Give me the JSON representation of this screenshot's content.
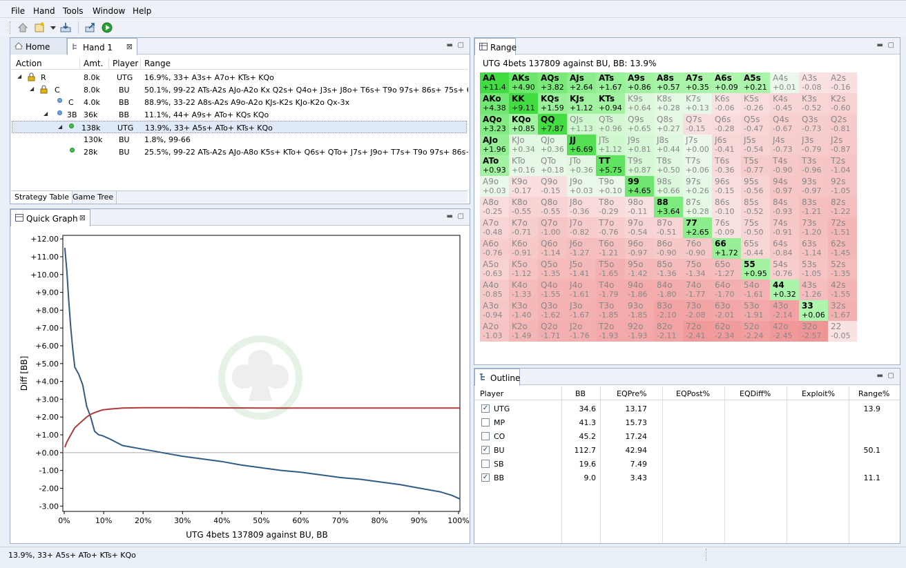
{
  "menu": [
    "File",
    "Hand",
    "Tools",
    "Window",
    "Help"
  ],
  "hand_panel": {
    "tabs": [
      "Home",
      "Hand 1"
    ],
    "headers": [
      "Action",
      "Amt.",
      "Player",
      "Range"
    ],
    "rows": [
      {
        "action": "R",
        "amt": "8.0k",
        "player": "UTG",
        "range": "16.9%, 33+ A3s+ A7o+ KTs+ KQo"
      },
      {
        "action": "C",
        "amt": "8.0k",
        "player": "BU",
        "range": "50.1%, 99-22 ATs-A2s AJo-A2o Kx Q2s+ Q4o+ J3s+ J8o+ T6s+ T9o 97s+ 86s+ 75s+ 64s+ 53"
      },
      {
        "action": "C",
        "amt": "4.0k",
        "player": "BB",
        "range": "88.9%, 33-22 A8s-A2s A9o-A2o KJs-K2s KJo-K2o Qx-3x"
      },
      {
        "action": "3B",
        "amt": "36k",
        "player": "BB",
        "range": "11.1%, 44+ A9s+ ATo+ KQs KQo"
      },
      {
        "action": "",
        "amt": "138k",
        "player": "UTG",
        "range": "13.9%, 33+ A5s+ ATo+ KTs+ KQo"
      },
      {
        "action": "",
        "amt": "130k",
        "player": "BU",
        "range": "1.8%, 99-66"
      },
      {
        "action": "",
        "amt": "28k",
        "player": "BU",
        "range": "25.5%, 99-22 ATs-A2s AJo-A8o K5s+ KTo+ Q6s+ QTo+ J7s+ J9o+ T7s+ T9o 97s+ 86s+ 75s."
      }
    ],
    "bottom_tabs": [
      "Strategy Table",
      "Game Tree"
    ]
  },
  "graph_panel": {
    "tab": "Quick Graph",
    "y_label": "Diff [BB]",
    "x_label": "UTG 4bets 137809 against BU, BB",
    "y_ticks": [
      "+12.00",
      "+11.00",
      "+10.00",
      "+9.00",
      "+8.00",
      "+7.00",
      "+6.00",
      "+5.00",
      "+4.00",
      "+3.00",
      "+2.00",
      "+1.00",
      "+0.00",
      "-1.00",
      "-2.00",
      "-3.00"
    ],
    "x_ticks": [
      "0%",
      "10%",
      "20%",
      "30%",
      "40%",
      "50%",
      "60%",
      "70%",
      "80%",
      "90%",
      "100%"
    ]
  },
  "chart_data": {
    "type": "line",
    "ylim": [
      -3.3,
      12.2
    ],
    "xlim": [
      0,
      100
    ],
    "series": [
      {
        "color": "#2f5b86",
        "x": [
          0.5,
          1,
          1.5,
          2,
          2.5,
          3,
          4,
          5,
          6,
          7,
          8,
          9,
          10,
          12,
          15,
          20,
          25,
          30,
          35,
          40,
          45,
          50,
          55,
          60,
          65,
          70,
          75,
          80,
          85,
          90,
          95,
          98,
          100
        ],
        "y": [
          11.5,
          10.2,
          8.5,
          7,
          5.8,
          4.8,
          4.4,
          3.8,
          2.6,
          2,
          1.2,
          1,
          0.95,
          0.75,
          0.4,
          0.2,
          0,
          -0.2,
          -0.35,
          -0.5,
          -0.7,
          -0.85,
          -1.0,
          -1.1,
          -1.25,
          -1.4,
          -1.5,
          -1.65,
          -1.8,
          -2.0,
          -2.2,
          -2.4,
          -2.6
        ]
      },
      {
        "color": "#b03a3a",
        "x": [
          0.5,
          1,
          2,
          3,
          4,
          5,
          6,
          7,
          8,
          10,
          12,
          15,
          20,
          30,
          50,
          70,
          90,
          100
        ],
        "y": [
          0.3,
          0.6,
          1.0,
          1.4,
          1.6,
          1.8,
          2.0,
          2.15,
          2.25,
          2.4,
          2.45,
          2.5,
          2.52,
          2.52,
          2.5,
          2.5,
          2.5,
          2.5
        ]
      }
    ]
  },
  "range_panel": {
    "tab": "Range",
    "title": "UTG 4bets 137809 against BU, BB: 13.9%",
    "grid": [
      [
        [
          "AA",
          "+11.4"
        ],
        [
          "AKs",
          "+4.90"
        ],
        [
          "AQs",
          "+3.82"
        ],
        [
          "AJs",
          "+2.64"
        ],
        [
          "ATs",
          "+1.67"
        ],
        [
          "A9s",
          "+0.86"
        ],
        [
          "A8s",
          "+0.57"
        ],
        [
          "A7s",
          "+0.35"
        ],
        [
          "A6s",
          "+0.09"
        ],
        [
          "A5s",
          "+0.21"
        ],
        [
          "A4s",
          "+0.01"
        ],
        [
          "A3s",
          "-0.08"
        ],
        [
          "A2s",
          "-0.16"
        ]
      ],
      [
        [
          "AKo",
          "+4.38"
        ],
        [
          "KK",
          "+9.11"
        ],
        [
          "KQs",
          "+1.59"
        ],
        [
          "KJs",
          "+1.12"
        ],
        [
          "KTs",
          "+0.94"
        ],
        [
          "K9s",
          "+0.64"
        ],
        [
          "K8s",
          "+0.28"
        ],
        [
          "K7s",
          "+0.13"
        ],
        [
          "K6s",
          "-0.06"
        ],
        [
          "K5s",
          "-0.26"
        ],
        [
          "K4s",
          "-0.45"
        ],
        [
          "K3s",
          "-0.52"
        ],
        [
          "K2s",
          "-0.60"
        ]
      ],
      [
        [
          "AQo",
          "+3.23"
        ],
        [
          "KQo",
          "+0.85"
        ],
        [
          "QQ",
          "+7.87"
        ],
        [
          "QJs",
          "+1.13"
        ],
        [
          "QTs",
          "+0.96"
        ],
        [
          "Q9s",
          "+0.65"
        ],
        [
          "Q8s",
          "+0.27"
        ],
        [
          "Q7s",
          "-0.15"
        ],
        [
          "Q6s",
          "-0.28"
        ],
        [
          "Q5s",
          "-0.47"
        ],
        [
          "Q4s",
          "-0.67"
        ],
        [
          "Q3s",
          "-0.73"
        ],
        [
          "Q2s",
          "-0.81"
        ]
      ],
      [
        [
          "AJo",
          "+1.96"
        ],
        [
          "KJo",
          "+0.34"
        ],
        [
          "QJo",
          "+0.36"
        ],
        [
          "JJ",
          "+6.69"
        ],
        [
          "JTs",
          "+1.12"
        ],
        [
          "J9s",
          "+0.81"
        ],
        [
          "J8s",
          "+0.44"
        ],
        [
          "J7s",
          "+0.00"
        ],
        [
          "J6s",
          "-0.41"
        ],
        [
          "J5s",
          "-0.54"
        ],
        [
          "J4s",
          "-0.73"
        ],
        [
          "J3s",
          "-0.79"
        ],
        [
          "J2s",
          "-0.87"
        ]
      ],
      [
        [
          "ATo",
          "+0.93"
        ],
        [
          "KTo",
          "+0.16"
        ],
        [
          "QTo",
          "+0.18"
        ],
        [
          "JTo",
          "+0.36"
        ],
        [
          "TT",
          "+5.75"
        ],
        [
          "T9s",
          "+0.87"
        ],
        [
          "T8s",
          "+0.50"
        ],
        [
          "T7s",
          "+0.06"
        ],
        [
          "T6s",
          "-0.36"
        ],
        [
          "T5s",
          "-0.77"
        ],
        [
          "T4s",
          "-0.90"
        ],
        [
          "T3s",
          "-0.96"
        ],
        [
          "T2s",
          "-1.04"
        ]
      ],
      [
        [
          "A9o",
          "+0.03"
        ],
        [
          "K9o",
          "-0.17"
        ],
        [
          "Q9o",
          "-0.15"
        ],
        [
          "J9o",
          "+0.03"
        ],
        [
          "T9o",
          "+0.10"
        ],
        [
          "99",
          "+4.65"
        ],
        [
          "98s",
          "+0.66"
        ],
        [
          "97s",
          "+0.26"
        ],
        [
          "96s",
          "-0.15"
        ],
        [
          "95s",
          "-0.56"
        ],
        [
          "94s",
          "-0.97"
        ],
        [
          "93s",
          "-0.97"
        ],
        [
          "92s",
          "-1.05"
        ]
      ],
      [
        [
          "A8o",
          "-0.25"
        ],
        [
          "K8o",
          "-0.55"
        ],
        [
          "Q8o",
          "-0.55"
        ],
        [
          "J8o",
          "-0.36"
        ],
        [
          "T8o",
          "-0.29"
        ],
        [
          "98o",
          "-0.11"
        ],
        [
          "88",
          "+3.64"
        ],
        [
          "87s",
          "+0.28"
        ],
        [
          "86s",
          "-0.10"
        ],
        [
          "85s",
          "-0.52"
        ],
        [
          "84s",
          "-0.93"
        ],
        [
          "83s",
          "-1.21"
        ],
        [
          "82s",
          "-1.22"
        ]
      ],
      [
        [
          "A7o",
          "-0.48"
        ],
        [
          "K7o",
          "-0.71"
        ],
        [
          "Q7o",
          "-1.00"
        ],
        [
          "J7o",
          "-0.82"
        ],
        [
          "T7o",
          "-0.76"
        ],
        [
          "97o",
          "-0.54"
        ],
        [
          "87o",
          "-0.51"
        ],
        [
          "77",
          "+2.65"
        ],
        [
          "76s",
          "-0.09"
        ],
        [
          "75s",
          "-0.50"
        ],
        [
          "74s",
          "-0.91"
        ],
        [
          "73s",
          "-1.20"
        ],
        [
          "72s",
          "-1.51"
        ]
      ],
      [
        [
          "A6o",
          "-0.76"
        ],
        [
          "K6o",
          "-0.91"
        ],
        [
          "Q6o",
          "-1.14"
        ],
        [
          "J6o",
          "-1.27"
        ],
        [
          "T6o",
          "-1.21"
        ],
        [
          "96o",
          "-0.97"
        ],
        [
          "86o",
          "-0.90"
        ],
        [
          "76o",
          "-0.90"
        ],
        [
          "66",
          "+1.72"
        ],
        [
          "65s",
          "-0.44"
        ],
        [
          "64s",
          "-0.84"
        ],
        [
          "63s",
          "-1.14"
        ],
        [
          "62s",
          "-1.45"
        ]
      ],
      [
        [
          "A5o",
          "-0.63"
        ],
        [
          "K5o",
          "-1.12"
        ],
        [
          "Q5o",
          "-1.35"
        ],
        [
          "J5o",
          "-1.41"
        ],
        [
          "T5o",
          "-1.65"
        ],
        [
          "95o",
          "-1.42"
        ],
        [
          "85o",
          "-1.36"
        ],
        [
          "75o",
          "-1.34"
        ],
        [
          "65o",
          "-1.27"
        ],
        [
          "55",
          "+0.95"
        ],
        [
          "54s",
          "-0.76"
        ],
        [
          "53s",
          "-1.05"
        ],
        [
          "52s",
          "-1.35"
        ]
      ],
      [
        [
          "A4o",
          "-0.85"
        ],
        [
          "K4o",
          "-1.33"
        ],
        [
          "Q4o",
          "-1.55"
        ],
        [
          "J4o",
          "-1.61"
        ],
        [
          "T4o",
          "-1.79"
        ],
        [
          "94o",
          "-1.86"
        ],
        [
          "84o",
          "-1.80"
        ],
        [
          "74o",
          "-1.77"
        ],
        [
          "64o",
          "-1.70"
        ],
        [
          "54o",
          "-1.61"
        ],
        [
          "44",
          "+0.32"
        ],
        [
          "43s",
          "-1.26"
        ],
        [
          "42s",
          "-1.55"
        ]
      ],
      [
        [
          "A3o",
          "-0.94"
        ],
        [
          "K3o",
          "-1.40"
        ],
        [
          "Q3o",
          "-1.62"
        ],
        [
          "J3o",
          "-1.67"
        ],
        [
          "T3o",
          "-1.85"
        ],
        [
          "93o",
          "-1.85"
        ],
        [
          "83o",
          "-2.10"
        ],
        [
          "73o",
          "-2.08"
        ],
        [
          "63o",
          "-2.01"
        ],
        [
          "53o",
          "-1.91"
        ],
        [
          "43o",
          "-2.14"
        ],
        [
          "33",
          "+0.06"
        ],
        [
          "32s",
          "-1.67"
        ]
      ],
      [
        [
          "A2o",
          "-1.03"
        ],
        [
          "K2o",
          "-1.49"
        ],
        [
          "Q2o",
          "-1.71"
        ],
        [
          "J2o",
          "-1.76"
        ],
        [
          "T2o",
          "-1.93"
        ],
        [
          "92o",
          "-1.93"
        ],
        [
          "82o",
          "-2.11"
        ],
        [
          "72o",
          "-2.41"
        ],
        [
          "62o",
          "-2.34"
        ],
        [
          "52o",
          "-2.24"
        ],
        [
          "42o",
          "-2.45"
        ],
        [
          "32o",
          "-2.57"
        ],
        [
          "22",
          "-0.05"
        ]
      ]
    ],
    "selected": [
      "AA",
      "KK",
      "QQ",
      "JJ",
      "TT",
      "99",
      "88",
      "77",
      "66",
      "55",
      "44",
      "33",
      "AKs",
      "AQs",
      "AJs",
      "ATs",
      "A9s",
      "A8s",
      "A7s",
      "A6s",
      "A5s",
      "KQs",
      "KJs",
      "KTs",
      "AKo",
      "AQo",
      "AJo",
      "ATo",
      "KQo"
    ]
  },
  "outline_panel": {
    "tab": "Outline",
    "headers": [
      "Player",
      "BB",
      "EQPre%",
      "EQPost%",
      "EQDiff%",
      "Exploit%",
      "Range%"
    ],
    "rows": [
      {
        "checked": true,
        "player": "UTG",
        "bb": "34.6",
        "eqpre": "13.17",
        "range": "13.9"
      },
      {
        "checked": false,
        "player": "MP",
        "bb": "41.3",
        "eqpre": "15.73",
        "range": ""
      },
      {
        "checked": false,
        "player": "CO",
        "bb": "45.2",
        "eqpre": "17.24",
        "range": ""
      },
      {
        "checked": true,
        "player": "BU",
        "bb": "112.7",
        "eqpre": "42.94",
        "range": "50.1"
      },
      {
        "checked": false,
        "player": "SB",
        "bb": "19.6",
        "eqpre": "7.49",
        "range": ""
      },
      {
        "checked": true,
        "player": "BB",
        "bb": "9.0",
        "eqpre": "3.43",
        "range": "11.1"
      }
    ]
  },
  "status": "13.9%, 33+ A5s+ ATo+ KTs+ KQo"
}
